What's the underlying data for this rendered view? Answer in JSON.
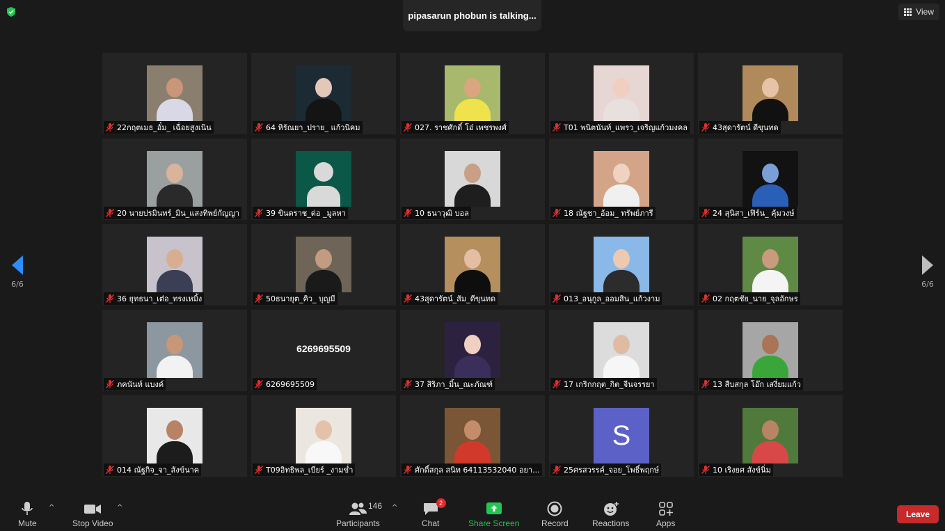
{
  "banner": {
    "talking": "pipasarun phobun is talking..."
  },
  "view_button": {
    "label": "View"
  },
  "pagination": {
    "left": "6/6",
    "right": "6/6"
  },
  "participants_grid": [
    {
      "name": "22กฤตเมธ_อั๋ม_ เฉื่อยสูงเนิน",
      "kind": "photo",
      "bg": "#8a7f6e",
      "skin": "#c99679",
      "shirt": "#d8d8e6"
    },
    {
      "name": "64 หิรัณยา_ปราย_ แก้วนิคม",
      "kind": "photo",
      "bg": "#1c2a33",
      "skin": "#e3c7b8",
      "shirt": "#141414"
    },
    {
      "name": "027. ราชศักดิ์ โอ๋ เพชรพงศ์",
      "kind": "photo",
      "bg": "#a8b86c",
      "skin": "#d9a680",
      "shirt": "#f0e24a"
    },
    {
      "name": "T01 พนิตนันท์_แพรว_เจริญแก้วมงคล",
      "kind": "photo",
      "bg": "#e6d6d4",
      "skin": "#f1cfc0",
      "shirt": "#e8e0dc"
    },
    {
      "name": "43สุดารัตน์ ดีขุนทด",
      "kind": "photo",
      "bg": "#b08a5a",
      "skin": "#e6c2a6",
      "shirt": "#111111"
    },
    {
      "name": "20 นายปรมินทร์_มิน_แสงทิพย์กัญญา",
      "kind": "photo",
      "bg": "#9aa0a0",
      "skin": "#d9b39a",
      "shirt": "#2a2a2a"
    },
    {
      "name": "39 ขินตราช_ต่อ _มูลหา",
      "kind": "default"
    },
    {
      "name": "10 ธนาวุฒิ บอล",
      "kind": "photo",
      "bg": "#d8d8d8",
      "skin": "#c9a086",
      "shirt": "#1e1e1e"
    },
    {
      "name": "18 ณัฐชา_อ้อม_ ทรัพย์ภารี",
      "kind": "photo",
      "bg": "#d4a489",
      "skin": "#f0d2c0",
      "shirt": "#f0f0f0"
    },
    {
      "name": "24 สุนิสา_เฟิร์น_ คุ้มวงษ์",
      "kind": "photo",
      "bg": "#121212",
      "skin": "#7a9fd6",
      "shirt": "#2a5fb8"
    },
    {
      "name": "36 ยุทธนา_เต๋อ_ทรงเหมิ้ง",
      "kind": "photo",
      "bg": "#c7c2cc",
      "skin": "#d8ae93",
      "shirt": "#3a3f55"
    },
    {
      "name": "50ธนายุต_คิว_ บุญมี",
      "kind": "photo",
      "bg": "#6e6458",
      "skin": "#c39b80",
      "shirt": "#1a1a1a"
    },
    {
      "name": "43สุดารัตน์_ส้ม_ดีขุนทด",
      "kind": "photo",
      "bg": "#b58f5e",
      "skin": "#e3bea2",
      "shirt": "#0e0e0e"
    },
    {
      "name": "013_อนุกูล_ออมสิน_แก้วงาม",
      "kind": "photo",
      "bg": "#8ab8e8",
      "skin": "#edc9b0",
      "shirt": "#2c2c2c"
    },
    {
      "name": "02 กฤตชัย_นาย_จุลอักษร",
      "kind": "photo",
      "bg": "#5f8a46",
      "skin": "#c99a7c",
      "shirt": "#f4f4f4"
    },
    {
      "name": "ภคนันท์ แบงค์",
      "kind": "photo",
      "bg": "#8c97a0",
      "skin": "#c7977a",
      "shirt": "#f2f2f2"
    },
    {
      "name": "6269695509",
      "kind": "number",
      "display": "6269695509"
    },
    {
      "name": "37  สิริภา_มิ้น_ณะภัณฑ์",
      "kind": "photo",
      "bg": "#2c2240",
      "skin": "#f0d0c0",
      "shirt": "#3a2e5a"
    },
    {
      "name": "17 เกริกกฤต_กิต_จีนจรรยา",
      "kind": "photo",
      "bg": "#dcdcdc",
      "skin": "#e0bba3",
      "shirt": "#f6f6f6"
    },
    {
      "name": "13 สืบสกุล โอ๊ก เสงี่ยมแก้ว",
      "kind": "photo",
      "bg": "#a6a6a6",
      "skin": "#a97556",
      "shirt": "#3aa63a"
    },
    {
      "name": "014 ณัฐกิจ_จา_สังข์นาค",
      "kind": "photo",
      "bg": "#e8e8e8",
      "skin": "#b88364",
      "shirt": "#1c1c1c"
    },
    {
      "name": "T09อิทธิพล_เบียร์ _งามข่ำ",
      "kind": "photo",
      "bg": "#ece6e0",
      "skin": "#e4c2aa",
      "shirt": "#f8f8f8"
    },
    {
      "name": "ศักดิ์สกุล สนิท 64113532040 อยา...",
      "kind": "photo",
      "bg": "#7a5636",
      "skin": "#c48c6a",
      "shirt": "#d13a2a"
    },
    {
      "name": "25ศรสวรรค์_จอย_โพธิ์พฤกษ์",
      "kind": "letter",
      "letter": "S"
    },
    {
      "name": "10 เริงยศ สังข์นิ่ม",
      "kind": "photo",
      "bg": "#4f7a3c",
      "skin": "#b98466",
      "shirt": "#d84848"
    }
  ],
  "toolbar": {
    "mute": "Mute",
    "stop_video": "Stop Video",
    "participants": "Participants",
    "participants_count": "146",
    "chat": "Chat",
    "chat_badge": "2",
    "share_screen": "Share Screen",
    "record": "Record",
    "reactions": "Reactions",
    "apps": "Apps",
    "leave": "Leave",
    "caret": "^"
  },
  "colors": {
    "share_green": "#23c552",
    "leave_red": "#c62a2a",
    "mic_muted_red": "#e0302e",
    "security_green": "#23c552"
  }
}
